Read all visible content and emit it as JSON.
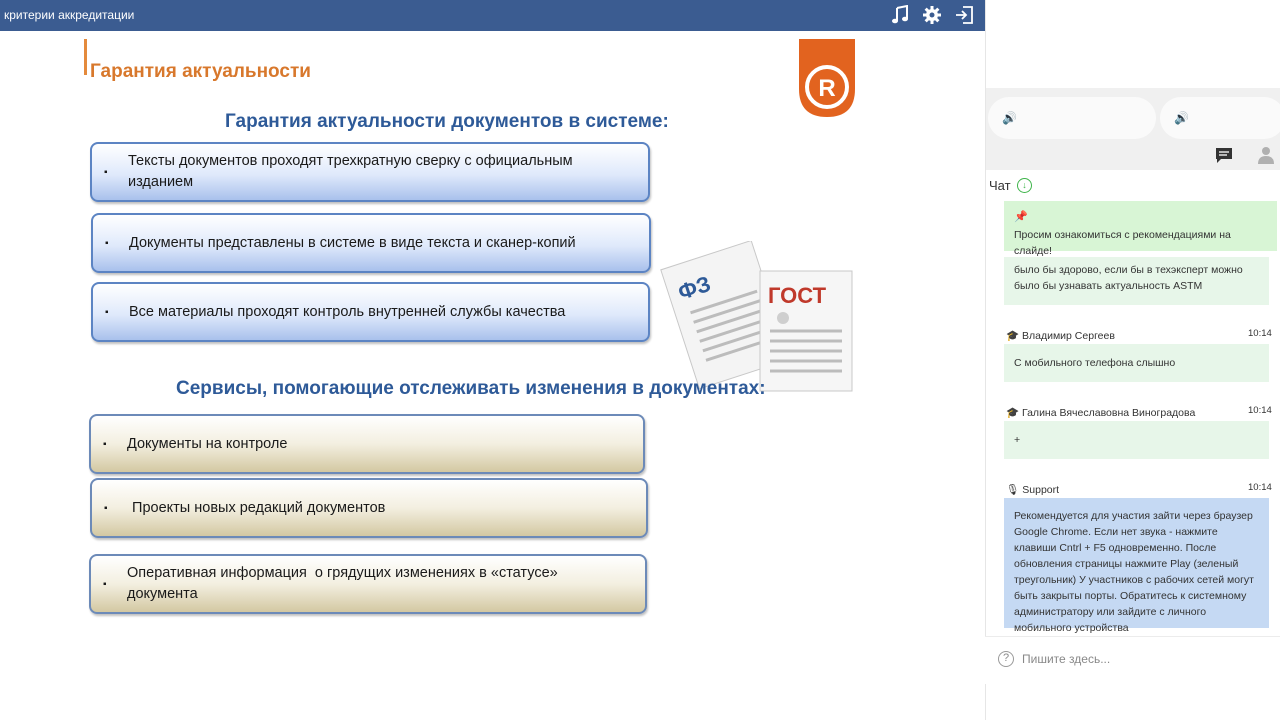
{
  "topbar": {
    "title": "критерии аккредитации",
    "icons": [
      "music-icon",
      "gear-icon",
      "exit-icon"
    ]
  },
  "slide": {
    "title": "Гарантия актуальности",
    "section1_heading": "Гарантия актуальности документов в системе:",
    "section1_items": [
      "Тексты документов проходят трехкратную сверку с официальным изданием",
      "Документы представлены в системе в виде текста и сканер-копий",
      "Все материалы проходят контроль внутренней службы качества"
    ],
    "section2_heading": "Сервисы, помогающие отслеживать изменения в документах:",
    "section2_items": [
      "Документы на контроле",
      " Проекты новых редакций документов",
      "Оперативная информация  о грядущих изменениях в «статусе» документа"
    ],
    "bullet": "▪",
    "doc_labels": {
      "left": "ФЗ",
      "right": "ГОСТ"
    },
    "colors": {
      "accent": "#d8782c",
      "heading": "#2e5a98",
      "logo": "#e2631f"
    }
  },
  "panel": {
    "chat_label": "Чат",
    "messages": {
      "pinned": "Просим ознакомиться с рекомендациями на слайде!",
      "m1": "было бы здорово, если бы в техэксперт можно было бы узнавать актуальность ASTM",
      "m2_author": "Владимир Сергеев",
      "m2_time": "10:14",
      "m2_text": "С мобильного телефона слышно",
      "m3_author": "Галина Вячеславовна Виноградова",
      "m3_time": "10:14",
      "m3_text": "+",
      "m4_author": "Support",
      "m4_time": "10:14",
      "m4_text": "Рекомендуется для участия зайти через браузер Google Chrome. Если нет звука - нажмите клавиши Cntrl + F5 одновременно. После обновления страницы нажмите Play (зеленый треугольник) У участников с рабочих сетей могут быть закрыты порты. Обратитесь к системному администратору или зайдите с личного мобильного устройства"
    },
    "input_placeholder": "Пишите здесь..."
  }
}
